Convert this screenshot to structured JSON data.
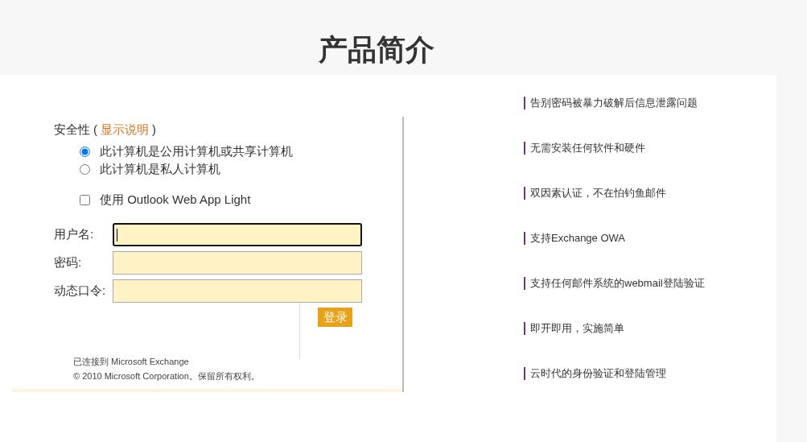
{
  "title": "产品简介",
  "login": {
    "security": {
      "label": "安全性",
      "open": "(",
      "link": "显示说明",
      "close": ")"
    },
    "computer_options": [
      {
        "label": "此计算机是公用计算机或共享计算机",
        "selected": true
      },
      {
        "label": "此计算机是私人计算机",
        "selected": false
      }
    ],
    "light_option": {
      "label": "使用 Outlook Web App Light",
      "checked": false
    },
    "fields": [
      {
        "label": "用户名:",
        "focused": true
      },
      {
        "label": "密码:",
        "focused": false
      },
      {
        "label": "动态口令:",
        "focused": false
      }
    ],
    "button": "登录",
    "footer": [
      "已连接到 Microsoft Exchange",
      "© 2010 Microsoft Corporation。保留所有权利。"
    ]
  },
  "features": [
    "告别密码被暴力破解后信息泄露问题",
    "无需安装任何软件和硬件",
    "双因素认证，不在怕钓鱼邮件",
    "支持Exchange OWA",
    "支持任何邮件系统的webmail登陆验证",
    "即开即用，实施简单",
    "云时代的身份验证和登陆管理"
  ]
}
